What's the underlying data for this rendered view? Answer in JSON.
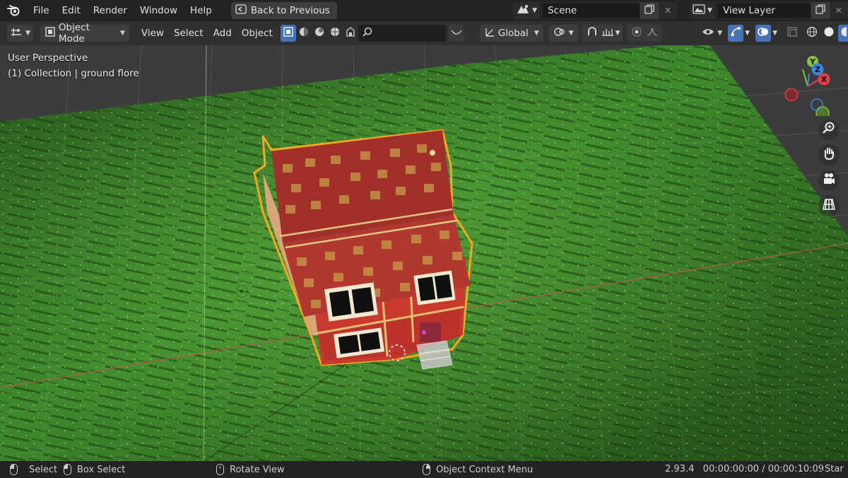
{
  "menu": {
    "items": [
      "File",
      "Edit",
      "Render",
      "Window",
      "Help"
    ],
    "back_button": "Back to Previous"
  },
  "scene": {
    "name": "Scene"
  },
  "view_layer": {
    "name": "View Layer"
  },
  "header": {
    "mode": "Object Mode",
    "menus": [
      "View",
      "Select",
      "Add",
      "Object"
    ],
    "transform_orientation": "Global"
  },
  "viewport": {
    "perspective_label": "User Perspective",
    "collection_label": "(1) Collection | ground flore",
    "gizmo": {
      "x": "X",
      "y": "Y",
      "z": "Z"
    }
  },
  "statusbar": {
    "select": "Select",
    "box_select": "Box Select",
    "rotate_view": "Rotate View",
    "context_menu": "Object Context Menu",
    "version_time": "2.93.4   00:00:00:00 / 00:00:10:09",
    "truncated": "Star"
  },
  "colors": {
    "accent": "#4772b3",
    "selection": "#f5a623",
    "x_axis": "#e8404a",
    "y_axis": "#86c33f",
    "z_axis": "#3e85e0"
  },
  "icons": [
    "blender-logo",
    "back-icon",
    "scene-icon",
    "copy-icon",
    "close-icon",
    "render-layer-icon",
    "editor-type-icon",
    "object-mode-icon",
    "select-box-icon",
    "search-icon",
    "global-orientation-icon",
    "pivot-icon",
    "snap-icon",
    "proportional-icon",
    "visibility-icon",
    "gizmo-icon",
    "overlay-icon",
    "xray-icon",
    "wireframe-icon",
    "solid-icon",
    "zoom-icon",
    "hand-icon",
    "camera-icon",
    "grid-icon"
  ]
}
